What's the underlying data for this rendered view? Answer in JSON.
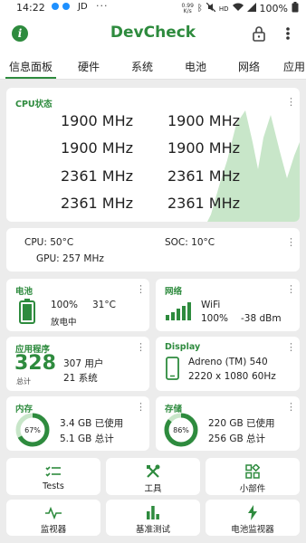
{
  "status_bar": {
    "time": "14:22",
    "carrier_label": "JD",
    "overflow_dots": "···",
    "speed_top": "0.99",
    "speed_bottom": "K/s",
    "hd_label": "HD",
    "battery_percent": "100%"
  },
  "app": {
    "title": "DevCheck",
    "info_icon": "i",
    "more_icon": "⋮"
  },
  "tabs": [
    "信息面板",
    "硬件",
    "系统",
    "电池",
    "网络",
    "应用"
  ],
  "cpu": {
    "title": "CPU状态",
    "freqs": [
      "1900 MHz",
      "1900 MHz",
      "1900 MHz",
      "1900 MHz",
      "2361 MHz",
      "2361 MHz",
      "2361 MHz",
      "2361 MHz"
    ]
  },
  "temps": {
    "cpu": "CPU: 50°C",
    "soc": "SOC: 10°C",
    "gpu": "GPU: 257 MHz"
  },
  "battery": {
    "title": "电池",
    "percent": "100%",
    "temp": "31°C",
    "status": "放电中"
  },
  "network": {
    "title": "网络",
    "type": "WiFi",
    "strength": "100%",
    "dbm": "-38 dBm"
  },
  "apps": {
    "title": "应用程序",
    "total": "328",
    "total_label": "总计",
    "user": "307 用户",
    "system": "21 系统"
  },
  "display": {
    "title": "Display",
    "gpu": "Adreno (TM) 540",
    "resolution": "2220 x 1080",
    "refresh": "60Hz"
  },
  "memory": {
    "title": "内存",
    "percent_label": "67%",
    "percent": 67,
    "used": "3.4 GB 已使用",
    "total": "5.1 GB 总计"
  },
  "storage": {
    "title": "存储",
    "percent_label": "86%",
    "percent": 86,
    "used": "220 GB 已使用",
    "total": "256 GB 总计"
  },
  "bottom_buttons": {
    "tests": "Tests",
    "tools": "工具",
    "widgets": "小部件",
    "monitor": "监视器",
    "benchmark": "基准测试",
    "battery_monitor": "电池监视器"
  },
  "colors": {
    "accent": "#2e8b3e",
    "graph_fill": "#c8e6c9"
  }
}
